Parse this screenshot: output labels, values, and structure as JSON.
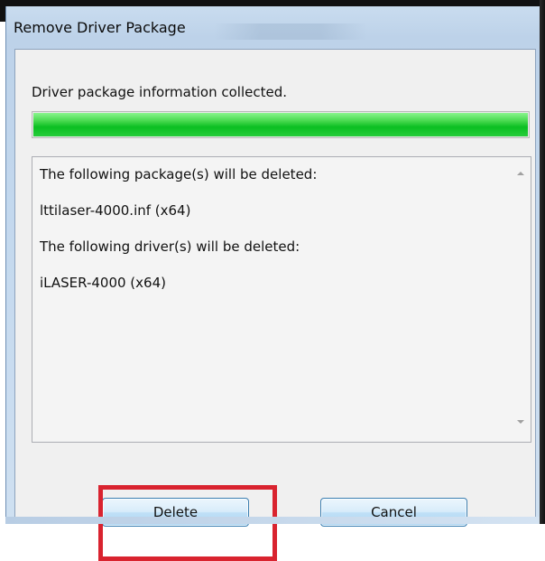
{
  "window": {
    "title": "Remove Driver Package"
  },
  "status": {
    "text": "Driver package information collected.",
    "progress_fraction": 1.0,
    "progress_color": "#1fc430"
  },
  "details": {
    "lines": [
      "The following package(s) will be deleted:",
      "lttilaser-4000.inf (x64)",
      "The following driver(s) will be deleted:",
      "iLASER-4000 (x64)"
    ]
  },
  "buttons": {
    "delete_label": "Delete",
    "cancel_label": "Cancel"
  },
  "annotation": {
    "highlight_color": "#d9232f"
  }
}
